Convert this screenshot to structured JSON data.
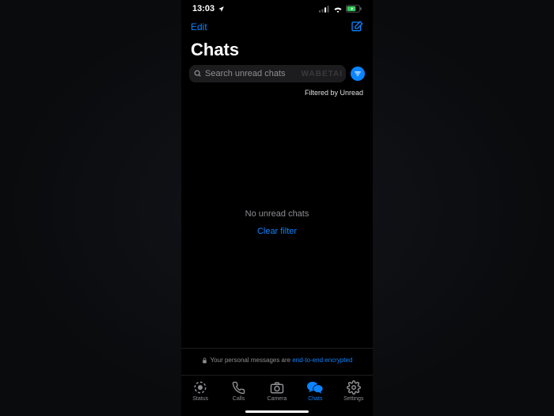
{
  "statusbar": {
    "time": "13:03"
  },
  "nav": {
    "edit": "Edit"
  },
  "title": "Chats",
  "search": {
    "placeholder": "Search unread chats",
    "watermark": "WABETAI"
  },
  "filtered_label": "Filtered by Unread",
  "empty": {
    "message": "No unread chats",
    "clear": "Clear filter"
  },
  "encryption": {
    "prefix": "Your personal messages are",
    "link": "end-to-end encrypted"
  },
  "tabs": {
    "status": "Status",
    "calls": "Calls",
    "camera": "Camera",
    "chats": "Chats",
    "settings": "Settings"
  }
}
